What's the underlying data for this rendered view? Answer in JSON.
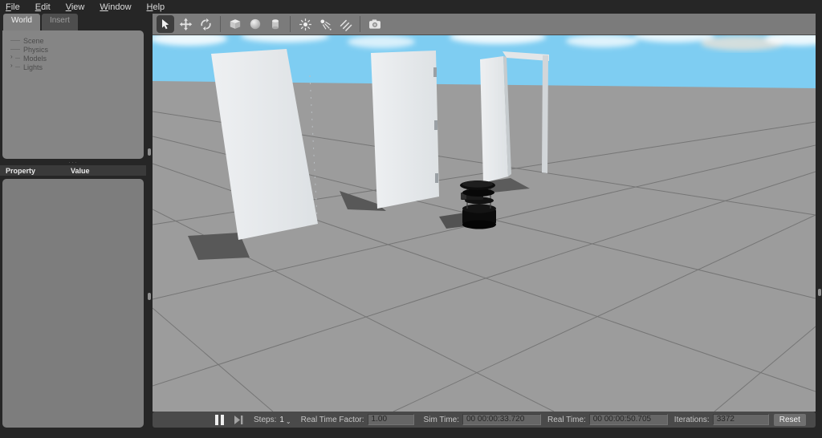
{
  "menu": {
    "items": [
      {
        "label": "File"
      },
      {
        "label": "Edit"
      },
      {
        "label": "View"
      },
      {
        "label": "Window"
      },
      {
        "label": "Help"
      }
    ]
  },
  "sidebar": {
    "tabs": [
      {
        "label": "World",
        "active": true
      },
      {
        "label": "Insert",
        "active": false
      }
    ],
    "expand_glyph": "›",
    "tree": [
      {
        "label": "Scene",
        "expandable": false
      },
      {
        "label": "Physics",
        "expandable": false
      },
      {
        "label": "Models",
        "expandable": true
      },
      {
        "label": "Lights",
        "expandable": true
      }
    ],
    "property_header": {
      "property": "Property",
      "value": "Value"
    }
  },
  "toolbar": {
    "tools": [
      "select",
      "translate",
      "rotate",
      "box",
      "sphere",
      "cylinder",
      "point-light",
      "spot-light",
      "directional-light",
      "screenshot"
    ]
  },
  "scene": {
    "objects": [
      "door-panel-left",
      "door-panel-middle",
      "door-frame-with-open-door",
      "turtlebot-robot"
    ],
    "sky_color": "#7ecdf2",
    "ground_color": "#9c9c9c",
    "grid_color": "#6f6f6f"
  },
  "statusbar": {
    "steps_label": "Steps:",
    "steps_value": "1",
    "rtf_label": "Real Time Factor:",
    "rtf_value": "1.00",
    "sim_time_label": "Sim Time:",
    "sim_time_value": "00 00:00:33.720",
    "real_time_label": "Real Time:",
    "real_time_value": "00 00:00:50.705",
    "iterations_label": "Iterations:",
    "iterations_value": "3372",
    "reset_label": "Reset"
  },
  "colors": {
    "window_bg": "#262626",
    "panel_gray": "#858585",
    "toolbar_gray": "#7b7b7b",
    "statusbar_gray": "#4a4a4a",
    "header_dark": "#3a3a3a"
  }
}
